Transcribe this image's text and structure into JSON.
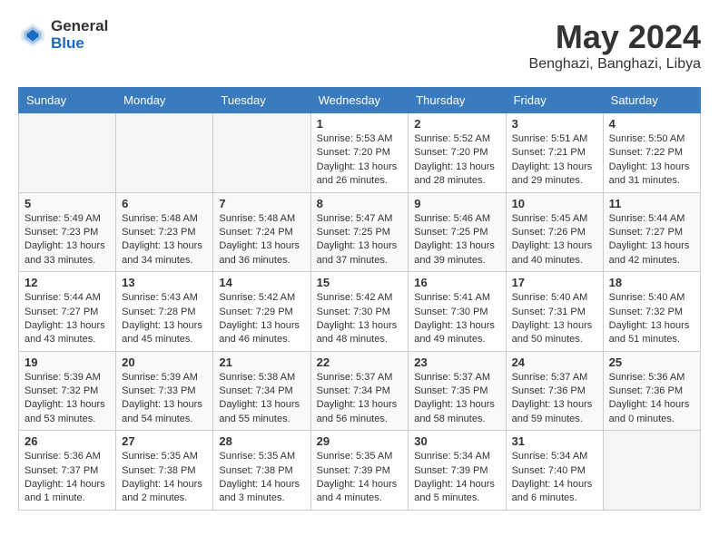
{
  "header": {
    "logo_general": "General",
    "logo_blue": "Blue",
    "month_title": "May 2024",
    "location": "Benghazi, Banghazi, Libya"
  },
  "weekdays": [
    "Sunday",
    "Monday",
    "Tuesday",
    "Wednesday",
    "Thursday",
    "Friday",
    "Saturday"
  ],
  "weeks": [
    [
      {
        "day": "",
        "sunrise": "",
        "sunset": "",
        "daylight": ""
      },
      {
        "day": "",
        "sunrise": "",
        "sunset": "",
        "daylight": ""
      },
      {
        "day": "",
        "sunrise": "",
        "sunset": "",
        "daylight": ""
      },
      {
        "day": "1",
        "sunrise": "Sunrise: 5:53 AM",
        "sunset": "Sunset: 7:20 PM",
        "daylight": "Daylight: 13 hours and 26 minutes."
      },
      {
        "day": "2",
        "sunrise": "Sunrise: 5:52 AM",
        "sunset": "Sunset: 7:20 PM",
        "daylight": "Daylight: 13 hours and 28 minutes."
      },
      {
        "day": "3",
        "sunrise": "Sunrise: 5:51 AM",
        "sunset": "Sunset: 7:21 PM",
        "daylight": "Daylight: 13 hours and 29 minutes."
      },
      {
        "day": "4",
        "sunrise": "Sunrise: 5:50 AM",
        "sunset": "Sunset: 7:22 PM",
        "daylight": "Daylight: 13 hours and 31 minutes."
      }
    ],
    [
      {
        "day": "5",
        "sunrise": "Sunrise: 5:49 AM",
        "sunset": "Sunset: 7:23 PM",
        "daylight": "Daylight: 13 hours and 33 minutes."
      },
      {
        "day": "6",
        "sunrise": "Sunrise: 5:48 AM",
        "sunset": "Sunset: 7:23 PM",
        "daylight": "Daylight: 13 hours and 34 minutes."
      },
      {
        "day": "7",
        "sunrise": "Sunrise: 5:48 AM",
        "sunset": "Sunset: 7:24 PM",
        "daylight": "Daylight: 13 hours and 36 minutes."
      },
      {
        "day": "8",
        "sunrise": "Sunrise: 5:47 AM",
        "sunset": "Sunset: 7:25 PM",
        "daylight": "Daylight: 13 hours and 37 minutes."
      },
      {
        "day": "9",
        "sunrise": "Sunrise: 5:46 AM",
        "sunset": "Sunset: 7:25 PM",
        "daylight": "Daylight: 13 hours and 39 minutes."
      },
      {
        "day": "10",
        "sunrise": "Sunrise: 5:45 AM",
        "sunset": "Sunset: 7:26 PM",
        "daylight": "Daylight: 13 hours and 40 minutes."
      },
      {
        "day": "11",
        "sunrise": "Sunrise: 5:44 AM",
        "sunset": "Sunset: 7:27 PM",
        "daylight": "Daylight: 13 hours and 42 minutes."
      }
    ],
    [
      {
        "day": "12",
        "sunrise": "Sunrise: 5:44 AM",
        "sunset": "Sunset: 7:27 PM",
        "daylight": "Daylight: 13 hours and 43 minutes."
      },
      {
        "day": "13",
        "sunrise": "Sunrise: 5:43 AM",
        "sunset": "Sunset: 7:28 PM",
        "daylight": "Daylight: 13 hours and 45 minutes."
      },
      {
        "day": "14",
        "sunrise": "Sunrise: 5:42 AM",
        "sunset": "Sunset: 7:29 PM",
        "daylight": "Daylight: 13 hours and 46 minutes."
      },
      {
        "day": "15",
        "sunrise": "Sunrise: 5:42 AM",
        "sunset": "Sunset: 7:30 PM",
        "daylight": "Daylight: 13 hours and 48 minutes."
      },
      {
        "day": "16",
        "sunrise": "Sunrise: 5:41 AM",
        "sunset": "Sunset: 7:30 PM",
        "daylight": "Daylight: 13 hours and 49 minutes."
      },
      {
        "day": "17",
        "sunrise": "Sunrise: 5:40 AM",
        "sunset": "Sunset: 7:31 PM",
        "daylight": "Daylight: 13 hours and 50 minutes."
      },
      {
        "day": "18",
        "sunrise": "Sunrise: 5:40 AM",
        "sunset": "Sunset: 7:32 PM",
        "daylight": "Daylight: 13 hours and 51 minutes."
      }
    ],
    [
      {
        "day": "19",
        "sunrise": "Sunrise: 5:39 AM",
        "sunset": "Sunset: 7:32 PM",
        "daylight": "Daylight: 13 hours and 53 minutes."
      },
      {
        "day": "20",
        "sunrise": "Sunrise: 5:39 AM",
        "sunset": "Sunset: 7:33 PM",
        "daylight": "Daylight: 13 hours and 54 minutes."
      },
      {
        "day": "21",
        "sunrise": "Sunrise: 5:38 AM",
        "sunset": "Sunset: 7:34 PM",
        "daylight": "Daylight: 13 hours and 55 minutes."
      },
      {
        "day": "22",
        "sunrise": "Sunrise: 5:37 AM",
        "sunset": "Sunset: 7:34 PM",
        "daylight": "Daylight: 13 hours and 56 minutes."
      },
      {
        "day": "23",
        "sunrise": "Sunrise: 5:37 AM",
        "sunset": "Sunset: 7:35 PM",
        "daylight": "Daylight: 13 hours and 58 minutes."
      },
      {
        "day": "24",
        "sunrise": "Sunrise: 5:37 AM",
        "sunset": "Sunset: 7:36 PM",
        "daylight": "Daylight: 13 hours and 59 minutes."
      },
      {
        "day": "25",
        "sunrise": "Sunrise: 5:36 AM",
        "sunset": "Sunset: 7:36 PM",
        "daylight": "Daylight: 14 hours and 0 minutes."
      }
    ],
    [
      {
        "day": "26",
        "sunrise": "Sunrise: 5:36 AM",
        "sunset": "Sunset: 7:37 PM",
        "daylight": "Daylight: 14 hours and 1 minute."
      },
      {
        "day": "27",
        "sunrise": "Sunrise: 5:35 AM",
        "sunset": "Sunset: 7:38 PM",
        "daylight": "Daylight: 14 hours and 2 minutes."
      },
      {
        "day": "28",
        "sunrise": "Sunrise: 5:35 AM",
        "sunset": "Sunset: 7:38 PM",
        "daylight": "Daylight: 14 hours and 3 minutes."
      },
      {
        "day": "29",
        "sunrise": "Sunrise: 5:35 AM",
        "sunset": "Sunset: 7:39 PM",
        "daylight": "Daylight: 14 hours and 4 minutes."
      },
      {
        "day": "30",
        "sunrise": "Sunrise: 5:34 AM",
        "sunset": "Sunset: 7:39 PM",
        "daylight": "Daylight: 14 hours and 5 minutes."
      },
      {
        "day": "31",
        "sunrise": "Sunrise: 5:34 AM",
        "sunset": "Sunset: 7:40 PM",
        "daylight": "Daylight: 14 hours and 6 minutes."
      },
      {
        "day": "",
        "sunrise": "",
        "sunset": "",
        "daylight": ""
      }
    ]
  ]
}
